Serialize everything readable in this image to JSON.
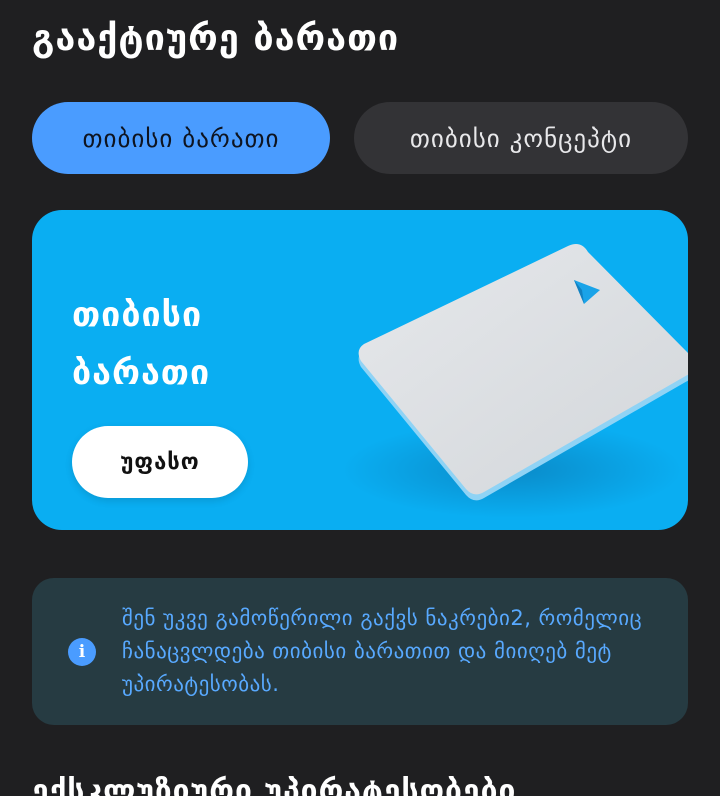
{
  "header": {
    "title": "გააქტიურე ბარათი"
  },
  "tabs": [
    {
      "label": "თიბისი ბარათი",
      "active": true
    },
    {
      "label": "თიბისი კონცეპტი",
      "active": false
    }
  ],
  "promo": {
    "title_line1": "თიბისი",
    "title_line2": "ბარათი",
    "button_label": "უფასო"
  },
  "notice": {
    "icon": "info-icon",
    "text": "შენ უკვე გამოწერილი გაქვს ნაკრები2, რომელიც ჩანაცვლდება თიბისი ბარათით და მიიღებ მეტ უპირატესობას."
  },
  "section": {
    "title": "ექსკლუზიური უპირატესობები"
  },
  "colors": {
    "background": "#1f1f21",
    "accent": "#4a9cff",
    "promo_bg": "#0aaef2",
    "notice_bg": "#263b42",
    "tab_inactive_bg": "#333336"
  }
}
